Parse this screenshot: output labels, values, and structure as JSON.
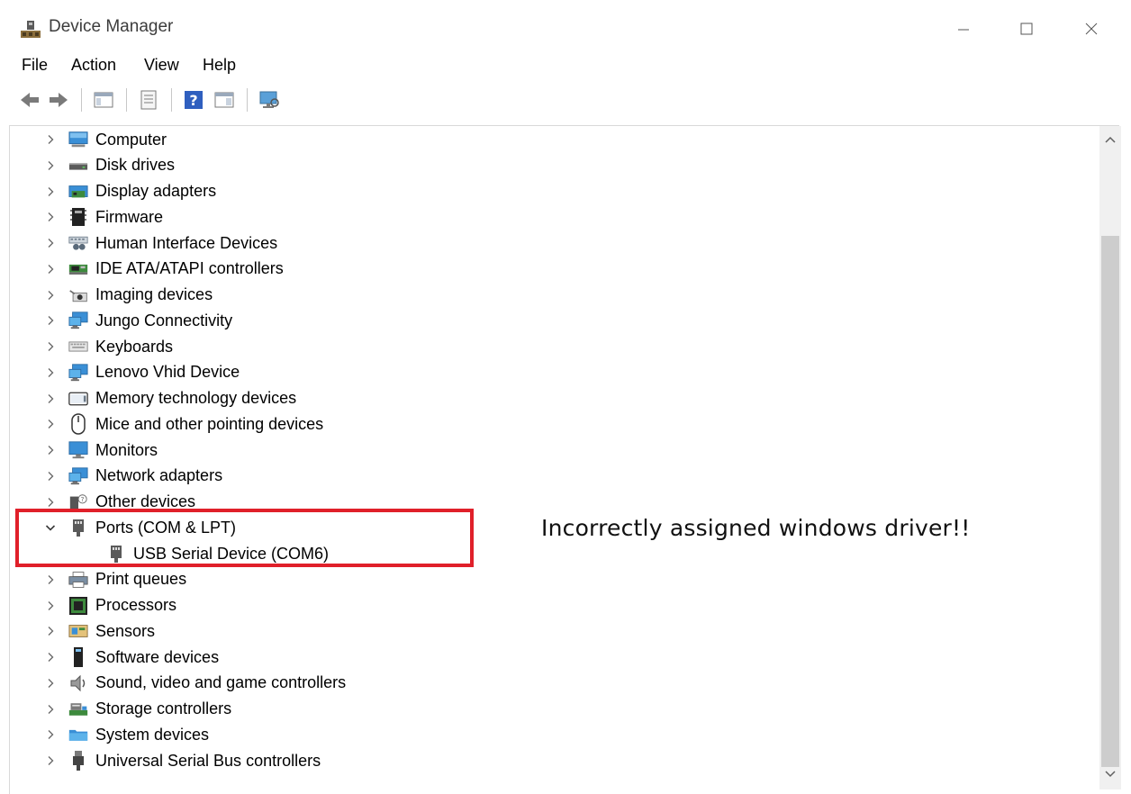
{
  "window": {
    "title": "Device Manager",
    "accent": "#0b63c4"
  },
  "menu": [
    {
      "label": "File"
    },
    {
      "label": "Action"
    },
    {
      "label": "View"
    },
    {
      "label": "Help"
    }
  ],
  "toolbar": {
    "buttons": [
      {
        "icon": "back-arrow-icon"
      },
      {
        "icon": "forward-arrow-icon"
      },
      {
        "icon": "show-hide-console-tree-icon"
      },
      {
        "icon": "properties-icon"
      },
      {
        "icon": "help-icon"
      },
      {
        "icon": "action-pane-icon"
      },
      {
        "icon": "monitor-scan-icon"
      }
    ]
  },
  "tree": [
    {
      "label": "Computer",
      "icon": "computer-icon",
      "expanded": false
    },
    {
      "label": "Disk drives",
      "icon": "disk-drive-icon",
      "expanded": false
    },
    {
      "label": "Display adapters",
      "icon": "display-adapter-icon",
      "expanded": false
    },
    {
      "label": "Firmware",
      "icon": "firmware-icon",
      "expanded": false
    },
    {
      "label": "Human Interface Devices",
      "icon": "hid-icon",
      "expanded": false
    },
    {
      "label": "IDE ATA/ATAPI controllers",
      "icon": "ide-controller-icon",
      "expanded": false
    },
    {
      "label": "Imaging devices",
      "icon": "camera-icon",
      "expanded": false
    },
    {
      "label": "Jungo Connectivity",
      "icon": "network-monitor-icon",
      "expanded": false
    },
    {
      "label": "Keyboards",
      "icon": "keyboard-icon",
      "expanded": false
    },
    {
      "label": "Lenovo Vhid Device",
      "icon": "network-monitor-icon",
      "expanded": false
    },
    {
      "label": "Memory technology devices",
      "icon": "memory-device-icon",
      "expanded": false
    },
    {
      "label": "Mice and other pointing devices",
      "icon": "mouse-icon",
      "expanded": false
    },
    {
      "label": "Monitors",
      "icon": "monitor-icon",
      "expanded": false
    },
    {
      "label": "Network adapters",
      "icon": "network-monitor-icon",
      "expanded": false
    },
    {
      "label": "Other devices",
      "icon": "unknown-device-icon",
      "expanded": false
    },
    {
      "label": "Ports (COM & LPT)",
      "icon": "port-plug-icon",
      "expanded": true
    },
    {
      "label": "USB Serial Device (COM6)",
      "icon": "port-plug-icon",
      "child": true
    },
    {
      "label": "Print queues",
      "icon": "printer-icon",
      "expanded": false
    },
    {
      "label": "Processors",
      "icon": "processor-icon",
      "expanded": false
    },
    {
      "label": "Sensors",
      "icon": "sensor-icon",
      "expanded": false
    },
    {
      "label": "Software devices",
      "icon": "software-device-icon",
      "expanded": false
    },
    {
      "label": "Sound, video and game controllers",
      "icon": "speaker-icon",
      "expanded": false
    },
    {
      "label": "Storage controllers",
      "icon": "storage-controller-icon",
      "expanded": false
    },
    {
      "label": "System devices",
      "icon": "system-folder-icon",
      "expanded": false
    },
    {
      "label": "Universal Serial Bus controllers",
      "icon": "usb-plug-icon",
      "expanded": false
    }
  ],
  "annotation": {
    "text": "Incorrectly assigned windows driver!!",
    "highlight_color": "#e0202a"
  }
}
